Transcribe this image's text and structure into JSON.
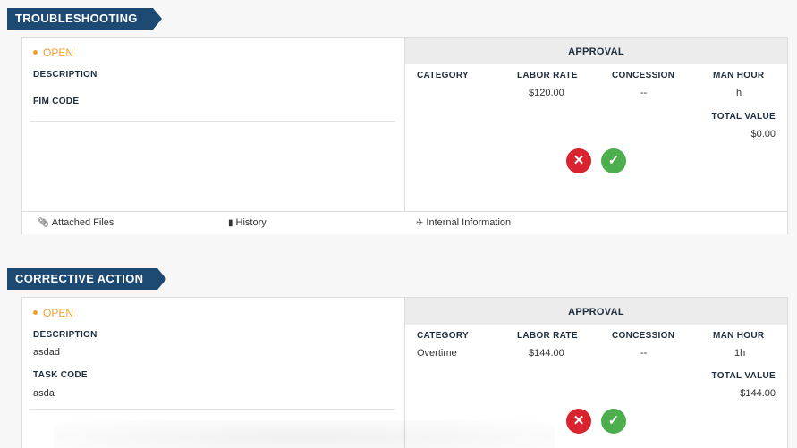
{
  "troubleshooting": {
    "title": "TROUBLESHOOTING",
    "status": "OPEN",
    "description_label": "DESCRIPTION",
    "description_value": "",
    "code_label": "FIM CODE",
    "code_value": "",
    "approval": {
      "title": "APPROVAL",
      "headers": {
        "category": "CATEGORY",
        "labor_rate": "LABOR RATE",
        "concession": "CONCESSION",
        "man_hour": "MAN HOUR"
      },
      "row": {
        "category": "",
        "labor_rate": "$120.00",
        "concession": "--",
        "man_hour": "h"
      },
      "total_label": "TOTAL VALUE",
      "total_value": "$0.00"
    },
    "footer": {
      "attached_files": "Attached Files",
      "history": "History",
      "internal_information": "Internal Information"
    }
  },
  "corrective_action": {
    "title": "CORRECTIVE ACTION",
    "status": "OPEN",
    "description_label": "DESCRIPTION",
    "description_value": "asdad",
    "code_label": "TASK CODE",
    "code_value": "asda",
    "approval": {
      "title": "APPROVAL",
      "headers": {
        "category": "CATEGORY",
        "labor_rate": "LABOR RATE",
        "concession": "CONCESSION",
        "man_hour": "MAN HOUR"
      },
      "row": {
        "category": "Overtime",
        "labor_rate": "$144.00",
        "concession": "--",
        "man_hour": "1h"
      },
      "total_label": "TOTAL VALUE",
      "total_value": "$144.00"
    }
  },
  "icons": {
    "reject": "close-circle-icon",
    "approve": "check-circle-icon",
    "attach": "paperclip-icon",
    "history": "book-icon",
    "internal": "plane-icon"
  },
  "colors": {
    "banner": "#1c4a73",
    "status_open": "#f0a030",
    "reject": "#d9232e",
    "approve": "#4cae4c"
  }
}
